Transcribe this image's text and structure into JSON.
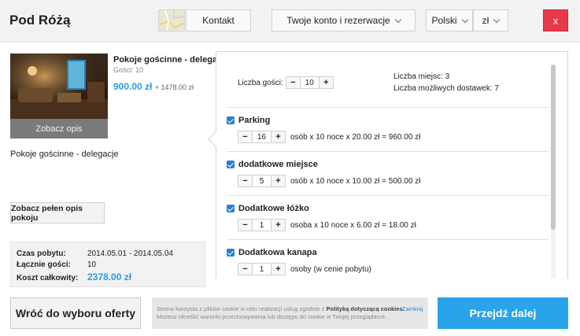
{
  "header": {
    "brand": "Pod Różą",
    "contact_label": "Kontakt",
    "account_label": "Twoje konto i rezerwacje",
    "language_label": "Polski",
    "currency_label": "zł",
    "close_label": "x"
  },
  "room": {
    "see_description_label": "Zobacz opis",
    "title": "Pokoje gościnne - delegacje",
    "guests_text": "Gości: 10",
    "price_main": "900.00 zł",
    "price_extra": "+ 1478.00 zł",
    "description": "Pokoje gościnne - delegacje",
    "full_description_label": "Zobacz pełen opis pokoju"
  },
  "summary": {
    "stay_label": "Czas pobytu:",
    "stay_value": "2014.05.01 - 2014.05.04",
    "guests_label": "Łącznie gości:",
    "guests_value": "10",
    "total_label": "Koszt całkowity:",
    "total_value": "2378.00 zł"
  },
  "panel": {
    "guests_label": "Liczba gości:",
    "guests_value": "10",
    "places_text": "Liczba miejsc: 3",
    "extra_beds_text": "Liczba możliwych dostawek: 7",
    "services": [
      {
        "name": "Parking",
        "qty": "16",
        "calc": "osób  x 10  noce x 20.00 zł = 960.00 zł",
        "checked": true
      },
      {
        "name": "dodatkowe miejsce",
        "qty": "5",
        "calc": "osób  x 10  noce x 10.00 zł = 500.00 zł",
        "checked": true
      },
      {
        "name": "Dodatkowe łóżko",
        "qty": "1",
        "calc": "osoba  x 10  noce x 6.00 zł = 18.00 zł",
        "checked": true
      },
      {
        "name": "Dodatkowa kanapa",
        "qty": "1",
        "calc": "osoby (w cenie pobytu)",
        "checked": true
      }
    ]
  },
  "footer": {
    "back_label": "Wróć do wyboru oferty",
    "cookie_line1_pre": "Strona korzysta z plików cookie w celu realizacji usług zgodnie z",
    "cookie_policy_link": "Polityką dotyczącą cookies",
    "cookie_line2": "Możesz określić warunki przechowywania lub dostępu do cookie w Twojej przeglądarce.",
    "cookie_close": "Zamknij",
    "next_label": "Przejdź dalej"
  },
  "colors": {
    "accent": "#29a3ea",
    "close_red": "#e8394a",
    "checkbox_blue": "#2a7fd4"
  }
}
